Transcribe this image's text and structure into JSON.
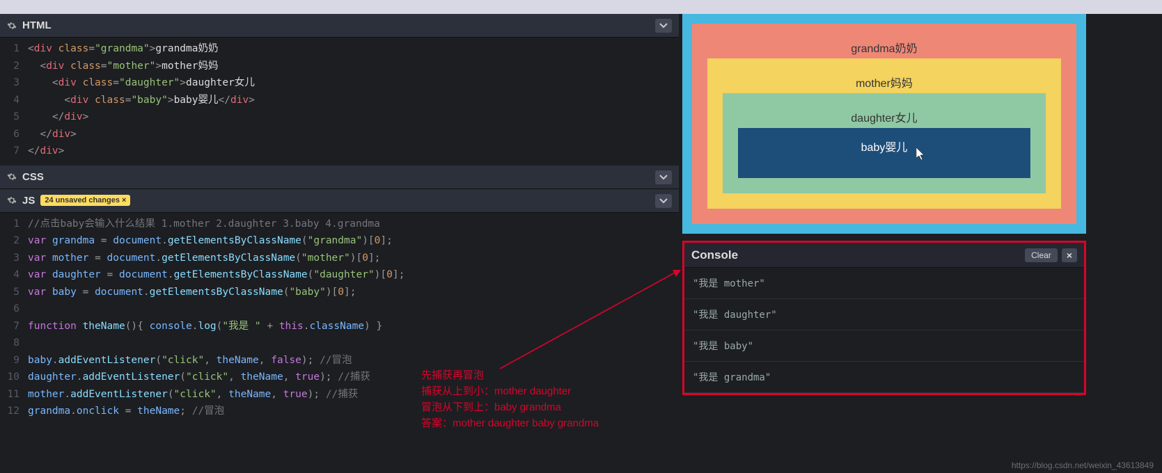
{
  "panels": {
    "html_label": "HTML",
    "css_label": "CSS",
    "js_label": "JS",
    "changes_badge": "24 unsaved changes ×"
  },
  "html_code": {
    "lines": [
      {
        "n": "1",
        "seg": [
          [
            "c-pun",
            "<"
          ],
          [
            "c-tag",
            "div"
          ],
          [
            "c-txt",
            " "
          ],
          [
            "c-attr",
            "class"
          ],
          [
            "c-pun",
            "="
          ],
          [
            "c-str",
            "\"grandma\""
          ],
          [
            "c-pun",
            ">"
          ],
          [
            "c-txt",
            "grandma奶奶"
          ]
        ]
      },
      {
        "n": "2",
        "seg": [
          [
            "c-txt",
            "  "
          ],
          [
            "c-pun",
            "<"
          ],
          [
            "c-tag",
            "div"
          ],
          [
            "c-txt",
            " "
          ],
          [
            "c-attr",
            "class"
          ],
          [
            "c-pun",
            "="
          ],
          [
            "c-str",
            "\"mother\""
          ],
          [
            "c-pun",
            ">"
          ],
          [
            "c-txt",
            "mother妈妈"
          ]
        ]
      },
      {
        "n": "3",
        "seg": [
          [
            "c-txt",
            "    "
          ],
          [
            "c-pun",
            "<"
          ],
          [
            "c-tag",
            "div"
          ],
          [
            "c-txt",
            " "
          ],
          [
            "c-attr",
            "class"
          ],
          [
            "c-pun",
            "="
          ],
          [
            "c-str",
            "\"daughter\""
          ],
          [
            "c-pun",
            ">"
          ],
          [
            "c-txt",
            "daughter女儿"
          ]
        ]
      },
      {
        "n": "4",
        "seg": [
          [
            "c-txt",
            "      "
          ],
          [
            "c-pun",
            "<"
          ],
          [
            "c-tag",
            "div"
          ],
          [
            "c-txt",
            " "
          ],
          [
            "c-attr",
            "class"
          ],
          [
            "c-pun",
            "="
          ],
          [
            "c-str",
            "\"baby\""
          ],
          [
            "c-pun",
            ">"
          ],
          [
            "c-txt",
            "baby婴儿"
          ],
          [
            "c-pun",
            "</"
          ],
          [
            "c-tag",
            "div"
          ],
          [
            "c-pun",
            ">"
          ]
        ]
      },
      {
        "n": "5",
        "seg": [
          [
            "c-txt",
            "    "
          ],
          [
            "c-pun",
            "</"
          ],
          [
            "c-tag",
            "div"
          ],
          [
            "c-pun",
            ">"
          ]
        ]
      },
      {
        "n": "6",
        "seg": [
          [
            "c-txt",
            "  "
          ],
          [
            "c-pun",
            "</"
          ],
          [
            "c-tag",
            "div"
          ],
          [
            "c-pun",
            ">"
          ]
        ]
      },
      {
        "n": "7",
        "seg": [
          [
            "c-pun",
            "</"
          ],
          [
            "c-tag",
            "div"
          ],
          [
            "c-pun",
            ">"
          ]
        ]
      }
    ]
  },
  "js_code": {
    "lines": [
      {
        "n": "1",
        "seg": [
          [
            "c-com",
            "//点击baby会输入什么结果 1.mother 2.daughter 3.baby 4.grandma"
          ]
        ]
      },
      {
        "n": "2",
        "seg": [
          [
            "c-kw",
            "var"
          ],
          [
            "c-txt",
            " "
          ],
          [
            "c-id",
            "grandma"
          ],
          [
            "c-txt",
            " "
          ],
          [
            "c-pun",
            "="
          ],
          [
            "c-txt",
            " "
          ],
          [
            "c-id",
            "document"
          ],
          [
            "c-pun",
            "."
          ],
          [
            "c-func",
            "getElementsByClassName"
          ],
          [
            "c-pun",
            "("
          ],
          [
            "c-str",
            "\"grandma\""
          ],
          [
            "c-pun",
            ")["
          ],
          [
            "c-num",
            "0"
          ],
          [
            "c-pun",
            "];"
          ]
        ]
      },
      {
        "n": "3",
        "seg": [
          [
            "c-kw",
            "var"
          ],
          [
            "c-txt",
            " "
          ],
          [
            "c-id",
            "mother"
          ],
          [
            "c-txt",
            " "
          ],
          [
            "c-pun",
            "="
          ],
          [
            "c-txt",
            " "
          ],
          [
            "c-id",
            "document"
          ],
          [
            "c-pun",
            "."
          ],
          [
            "c-func",
            "getElementsByClassName"
          ],
          [
            "c-pun",
            "("
          ],
          [
            "c-str",
            "\"mother\""
          ],
          [
            "c-pun",
            ")["
          ],
          [
            "c-num",
            "0"
          ],
          [
            "c-pun",
            "];"
          ]
        ]
      },
      {
        "n": "4",
        "seg": [
          [
            "c-kw",
            "var"
          ],
          [
            "c-txt",
            " "
          ],
          [
            "c-id",
            "daughter"
          ],
          [
            "c-txt",
            " "
          ],
          [
            "c-pun",
            "="
          ],
          [
            "c-txt",
            " "
          ],
          [
            "c-id",
            "document"
          ],
          [
            "c-pun",
            "."
          ],
          [
            "c-func",
            "getElementsByClassName"
          ],
          [
            "c-pun",
            "("
          ],
          [
            "c-str",
            "\"daughter\""
          ],
          [
            "c-pun",
            ")["
          ],
          [
            "c-num",
            "0"
          ],
          [
            "c-pun",
            "];"
          ]
        ]
      },
      {
        "n": "5",
        "seg": [
          [
            "c-kw",
            "var"
          ],
          [
            "c-txt",
            " "
          ],
          [
            "c-id",
            "baby"
          ],
          [
            "c-txt",
            " "
          ],
          [
            "c-pun",
            "="
          ],
          [
            "c-txt",
            " "
          ],
          [
            "c-id",
            "document"
          ],
          [
            "c-pun",
            "."
          ],
          [
            "c-func",
            "getElementsByClassName"
          ],
          [
            "c-pun",
            "("
          ],
          [
            "c-str",
            "\"baby\""
          ],
          [
            "c-pun",
            ")["
          ],
          [
            "c-num",
            "0"
          ],
          [
            "c-pun",
            "];"
          ]
        ]
      },
      {
        "n": "6",
        "seg": []
      },
      {
        "n": "7",
        "seg": [
          [
            "c-kw",
            "function"
          ],
          [
            "c-txt",
            " "
          ],
          [
            "c-func",
            "theName"
          ],
          [
            "c-pun",
            "(){"
          ],
          [
            "c-txt",
            " "
          ],
          [
            "c-id",
            "console"
          ],
          [
            "c-pun",
            "."
          ],
          [
            "c-func",
            "log"
          ],
          [
            "c-pun",
            "("
          ],
          [
            "c-str",
            "\"我是 \""
          ],
          [
            "c-txt",
            " "
          ],
          [
            "c-pun",
            "+"
          ],
          [
            "c-txt",
            " "
          ],
          [
            "c-kw",
            "this"
          ],
          [
            "c-pun",
            "."
          ],
          [
            "c-id",
            "className"
          ],
          [
            "c-pun",
            ") }"
          ]
        ]
      },
      {
        "n": "8",
        "seg": []
      },
      {
        "n": "9",
        "seg": [
          [
            "c-id",
            "baby"
          ],
          [
            "c-pun",
            "."
          ],
          [
            "c-func",
            "addEventListener"
          ],
          [
            "c-pun",
            "("
          ],
          [
            "c-str",
            "\"click\""
          ],
          [
            "c-pun",
            ", "
          ],
          [
            "c-id",
            "theName"
          ],
          [
            "c-pun",
            ", "
          ],
          [
            "c-kw",
            "false"
          ],
          [
            "c-pun",
            ");"
          ],
          [
            "c-txt",
            " "
          ],
          [
            "c-com",
            "//冒泡"
          ]
        ]
      },
      {
        "n": "10",
        "seg": [
          [
            "c-id",
            "daughter"
          ],
          [
            "c-pun",
            "."
          ],
          [
            "c-func",
            "addEventListener"
          ],
          [
            "c-pun",
            "("
          ],
          [
            "c-str",
            "\"click\""
          ],
          [
            "c-pun",
            ", "
          ],
          [
            "c-id",
            "theName"
          ],
          [
            "c-pun",
            ", "
          ],
          [
            "c-kw",
            "true"
          ],
          [
            "c-pun",
            ");"
          ],
          [
            "c-txt",
            " "
          ],
          [
            "c-com",
            "//捕获"
          ]
        ]
      },
      {
        "n": "11",
        "seg": [
          [
            "c-id",
            "mother"
          ],
          [
            "c-pun",
            "."
          ],
          [
            "c-func",
            "addEventListener"
          ],
          [
            "c-pun",
            "("
          ],
          [
            "c-str",
            "\"click\""
          ],
          [
            "c-pun",
            ", "
          ],
          [
            "c-id",
            "theName"
          ],
          [
            "c-pun",
            ", "
          ],
          [
            "c-kw",
            "true"
          ],
          [
            "c-pun",
            ");"
          ],
          [
            "c-txt",
            " "
          ],
          [
            "c-com",
            "//捕获"
          ]
        ]
      },
      {
        "n": "12",
        "seg": [
          [
            "c-id",
            "grandma"
          ],
          [
            "c-pun",
            "."
          ],
          [
            "c-id",
            "onclick"
          ],
          [
            "c-txt",
            " "
          ],
          [
            "c-pun",
            "="
          ],
          [
            "c-txt",
            " "
          ],
          [
            "c-id",
            "theName"
          ],
          [
            "c-pun",
            ";"
          ],
          [
            "c-txt",
            " "
          ],
          [
            "c-com",
            "//冒泡"
          ]
        ]
      }
    ]
  },
  "preview": {
    "grandma": "grandma奶奶",
    "mother": "mother妈妈",
    "daughter": "daughter女儿",
    "baby": "baby婴儿"
  },
  "console": {
    "title": "Console",
    "clear": "Clear",
    "close": "×",
    "lines": [
      "\"我是 mother\"",
      "\"我是 daughter\"",
      "\"我是 baby\"",
      "\"我是 grandma\""
    ]
  },
  "annotation": {
    "l1": "先捕获再冒泡",
    "l2": "捕获从上到小：mother daughter",
    "l3": "冒泡从下到上：baby grandma",
    "l4": "答案：mother daughter baby grandma"
  },
  "watermark": "https://blog.csdn.net/weixin_43613849"
}
